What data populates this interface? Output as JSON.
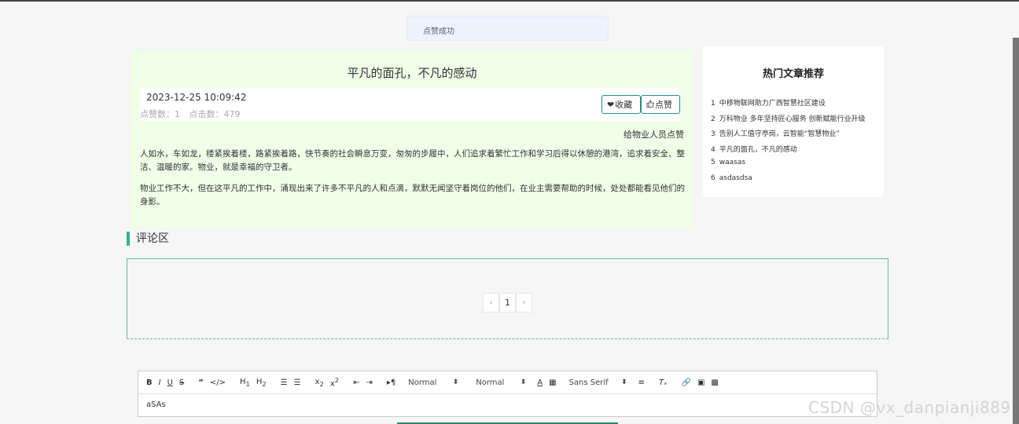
{
  "toast": {
    "message": "点赞成功"
  },
  "article": {
    "title": "平凡的面孔，不凡的感动",
    "date": "2023-12-25 10:09:42",
    "likes": "点赞数：1",
    "clicks": "点击数：479",
    "fav_label": "收藏",
    "like_label": "点赞",
    "author_note": "给物业人员点赞",
    "paragraphs": [
      "人如水，车如龙，楼紧挨着楼，路紧挨着路，快节奏的社会瞬息万变，匆匆的步履中，人们追求着繁忙工作和学习后得以休憩的港湾，追求着安全、整洁、温暖的家。物业，就是幸福的守卫者。",
      "物业工作不大，但在这平凡的工作中，涌现出来了许多不平凡的人和点滴，默默无闻坚守着岗位的他们，在业主需要帮助的时候，处处都能看见他们的身影。"
    ]
  },
  "hot": {
    "title": "热门文章推荐",
    "items": [
      {
        "idx": "1",
        "text": "中移物联网助力广西智慧社区建设"
      },
      {
        "idx": "2",
        "text": "万科物业 多年坚持匠心服务 创新赋能行业升级"
      },
      {
        "idx": "3",
        "text": "告别人工值守亭岗，云智能“智慧物业”"
      },
      {
        "idx": "4",
        "text": "平凡的面孔，不凡的感动"
      },
      {
        "idx": "5",
        "text": "waasas"
      },
      {
        "idx": "6",
        "text": "asdasdsa"
      }
    ]
  },
  "comments": {
    "heading": "评论区",
    "pager": {
      "prev": "‹",
      "current": "1",
      "next": "›"
    }
  },
  "editor": {
    "header_select": "Normal",
    "size_select": "Normal",
    "font_select": "Sans Serif",
    "content": "aSAs"
  },
  "watermark": "CSDN @vx_danpianji889",
  "colors": {
    "accent": "#2bb39a",
    "article_bg": "#efffe8",
    "toast_bg": "#edf2fc"
  }
}
